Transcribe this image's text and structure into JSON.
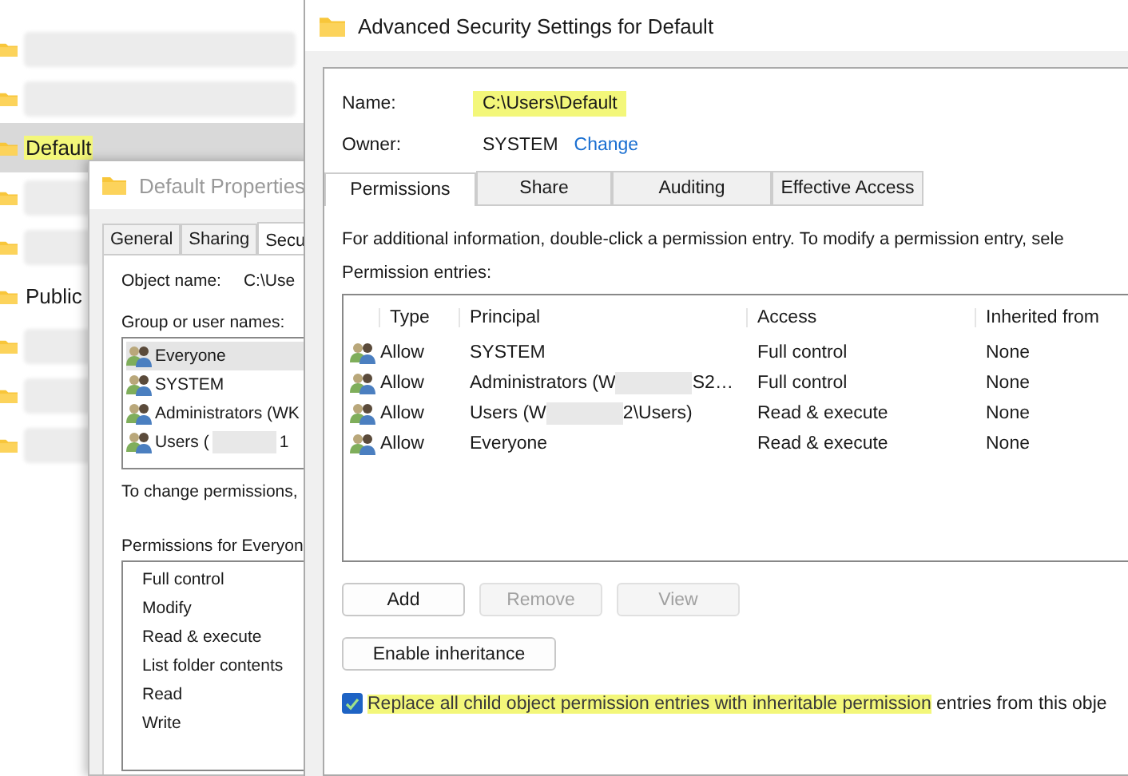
{
  "explorer": {
    "items": [
      {
        "kind": "redacted",
        "selected": false
      },
      {
        "kind": "redacted",
        "selected": false
      },
      {
        "kind": "folder",
        "label": "Default",
        "selected": true
      },
      {
        "kind": "redacted",
        "selected": false
      },
      {
        "kind": "redacted",
        "selected": false
      },
      {
        "kind": "folder",
        "label": "Public",
        "selected": false
      },
      {
        "kind": "redacted",
        "selected": false
      },
      {
        "kind": "redacted",
        "selected": false
      },
      {
        "kind": "redacted",
        "selected": false
      }
    ]
  },
  "properties_dialog": {
    "title": "Default Properties",
    "tabs": [
      {
        "label": "General",
        "selected": false
      },
      {
        "label": "Sharing",
        "selected": false
      },
      {
        "label": "Secu",
        "selected": true
      }
    ],
    "object_name_label": "Object name:",
    "object_name": "C:\\Use",
    "group_label": "Group or user names:",
    "principals": [
      {
        "name": "Everyone",
        "selected": true
      },
      {
        "name": "SYSTEM",
        "selected": false
      },
      {
        "name": "Administrators (WK",
        "selected": false
      },
      {
        "name": "Users (",
        "redacted": true,
        "name_end": "1",
        "selected": false
      }
    ],
    "change_hint": "To change permissions,",
    "permissions_label": "Permissions for Everyon",
    "permissions": [
      "Full control",
      "Modify",
      "Read & execute",
      "List folder contents",
      "Read",
      "Write"
    ]
  },
  "advanced_dialog": {
    "title": "Advanced Security Settings for Default",
    "name_label": "Name:",
    "name_value": "C:\\Users\\Default",
    "owner_label": "Owner:",
    "owner": "SYSTEM",
    "owner_link": "Change",
    "tabs": [
      {
        "label": "Permissions",
        "selected": true
      },
      {
        "label": "Share",
        "selected": false
      },
      {
        "label": "Auditing",
        "selected": false
      },
      {
        "label": "Effective Access",
        "selected": false
      }
    ],
    "info": "For additional information, double-click a permission entry. To modify a permission entry, sele",
    "entries_label": "Permission entries:",
    "table": {
      "columns": [
        "Type",
        "Principal",
        "Access",
        "Inherited from"
      ],
      "rows": [
        {
          "type": "Allow",
          "principal": "SYSTEM",
          "access": "Full control",
          "inherited": "None"
        },
        {
          "type": "Allow",
          "principal": "Administrators (W",
          "redacted": true,
          "principal_end": "S2…",
          "access": "Full control",
          "inherited": "None"
        },
        {
          "type": "Allow",
          "principal": "Users (W",
          "redacted": true,
          "principal_end": "2\\Users)",
          "access": "Read & execute",
          "inherited": "None"
        },
        {
          "type": "Allow",
          "principal": "Everyone",
          "access": "Read & execute",
          "inherited": "None"
        }
      ]
    },
    "buttons": [
      {
        "label": "Add",
        "disabled": false
      },
      {
        "label": "Remove",
        "disabled": true
      },
      {
        "label": "View",
        "disabled": true
      }
    ],
    "inheritance_button": "Enable inheritance",
    "replace_checkbox": {
      "checked": true,
      "label": "Replace all child object permission entries with inheritable permission",
      "label_rest": " entries from this obje"
    }
  }
}
